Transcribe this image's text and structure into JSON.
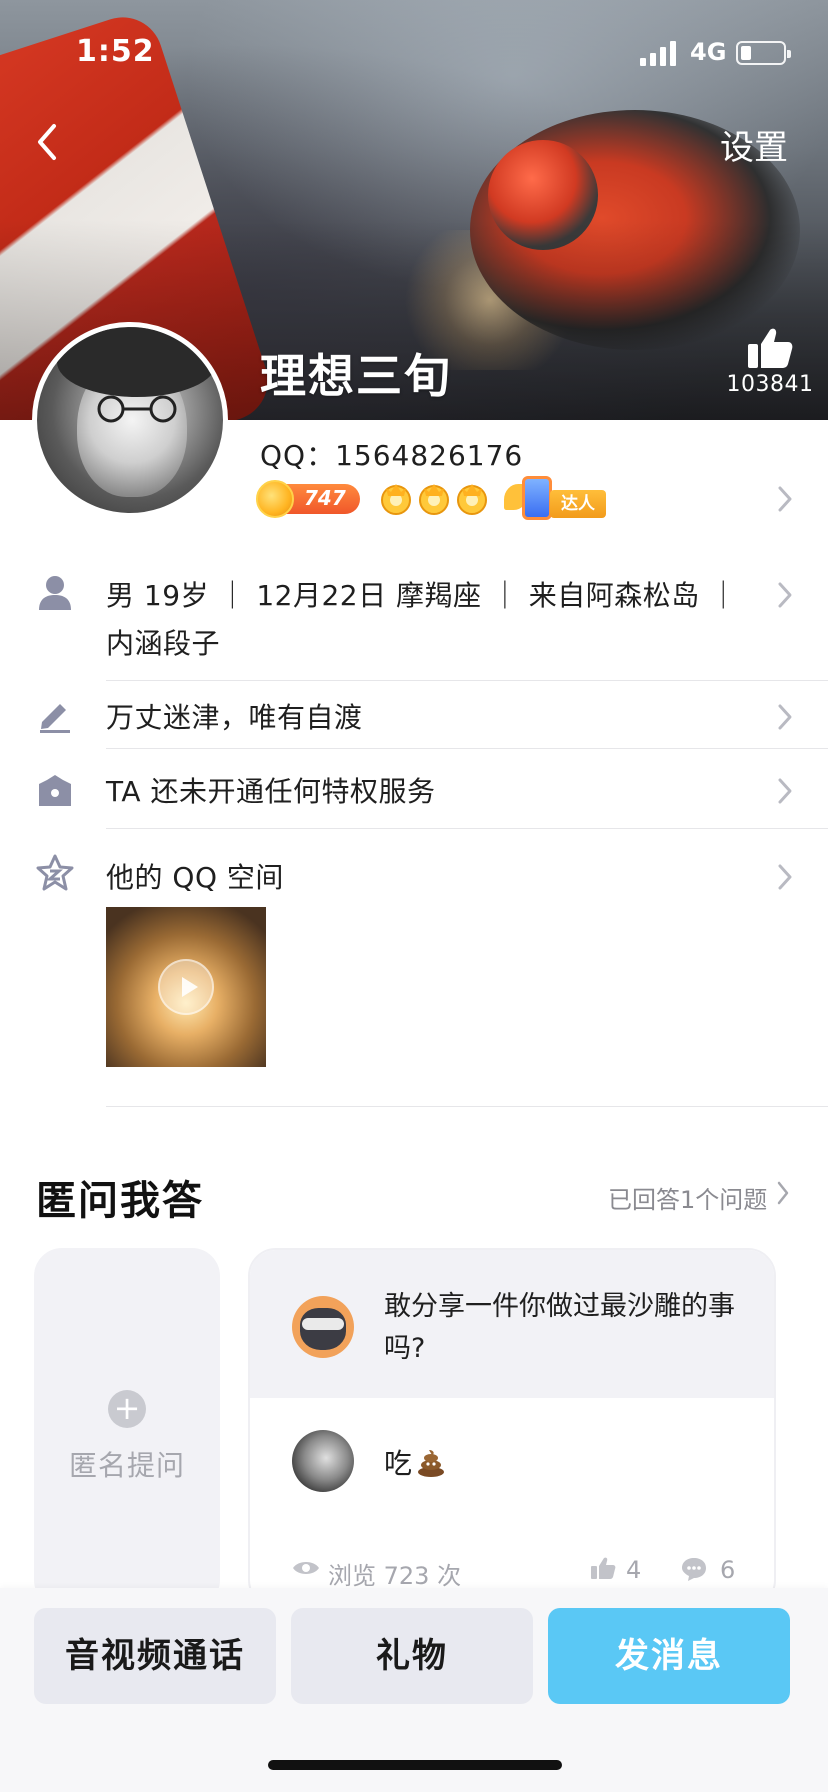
{
  "status_bar": {
    "time": "1:52",
    "network": "4G",
    "battery_level": 0.25,
    "signal_bars": 4
  },
  "header": {
    "back_icon": "chevron-left-icon",
    "settings_label": "设置",
    "nickname": "理想三旬",
    "like_icon": "thumbs-up-icon",
    "like_count": "103841"
  },
  "profile": {
    "qq_label": "QQ：1564826176",
    "level_number": "747",
    "crown_count": 3,
    "expert_badge_label": "达人",
    "info_line_1": "男 19岁 ｜ 12月22日 摩羯座 ｜ 来自阿森松岛 ｜",
    "info_line_2": "内涵段子",
    "signature": "万丈迷津，唯有自渡",
    "privilege": "TA 还未开通任何特权服务",
    "qzone_label": "他的 QQ 空间"
  },
  "qa": {
    "title": "匿问我答",
    "answered_count_label": "已回答1个问题",
    "ask_label": "匿名提问",
    "question": "敢分享一件你做过最沙雕的事吗?",
    "answer": "吃",
    "answer_emoji": "poop-emoji",
    "views_label": "浏览 723 次",
    "likes": "4",
    "comments": "6"
  },
  "bottom_bar": {
    "call_label": "音视频通话",
    "gift_label": "礼物",
    "message_label": "发消息"
  },
  "colors": {
    "accent_blue": "#5ac8f5",
    "button_gray": "#e8e9f0",
    "icon_gray": "#8c8fa6",
    "level_orange": "#f0572a",
    "badge_gold": "#f29b1b"
  }
}
